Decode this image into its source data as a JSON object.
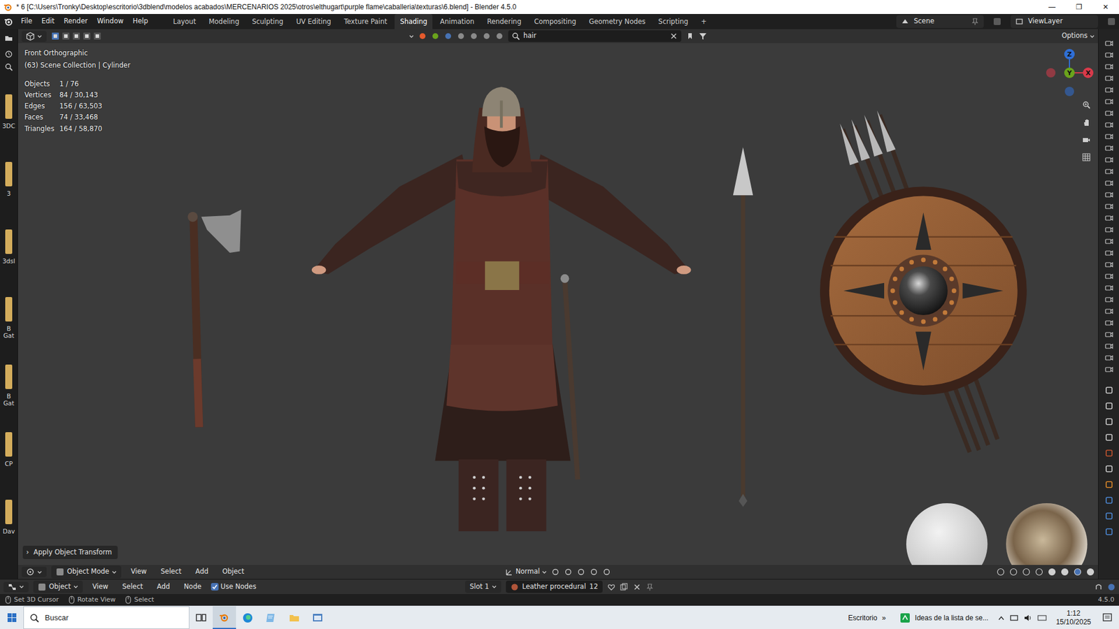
{
  "window": {
    "title": "* 6 [C:\\Users\\Tronky\\Desktop\\escritorio\\3dblend\\modelos acabados\\MERCENARIOS 2025\\otros\\elthugart\\purple flame\\caballeria\\texturas\\6.blend] - Blender 4.5.0",
    "controls": [
      "—",
      "❐",
      "✕"
    ]
  },
  "menubar": [
    "File",
    "Edit",
    "Render",
    "Window",
    "Help"
  ],
  "workspaces": [
    {
      "label": "Layout",
      "selected": false
    },
    {
      "label": "Modeling",
      "selected": false
    },
    {
      "label": "Sculpting",
      "selected": false
    },
    {
      "label": "UV Editing",
      "selected": false
    },
    {
      "label": "Texture Paint",
      "selected": false
    },
    {
      "label": "Shading",
      "selected": true
    },
    {
      "label": "Animation",
      "selected": false
    },
    {
      "label": "Rendering",
      "selected": false
    },
    {
      "label": "Compositing",
      "selected": false
    },
    {
      "label": "Geometry Nodes",
      "selected": false
    },
    {
      "label": "Scripting",
      "selected": false
    },
    {
      "label": "+",
      "selected": false
    }
  ],
  "topbar_right": {
    "scene": "Scene",
    "view_layer": "ViewLayer"
  },
  "file_strip": [
    {
      "lines": [
        "3DC"
      ]
    },
    {
      "lines": [
        "3"
      ]
    },
    {
      "lines": [
        "3dsl"
      ]
    },
    {
      "lines": [
        "B",
        "Gat"
      ]
    },
    {
      "lines": [
        "B",
        "Gat"
      ]
    },
    {
      "lines": [
        "CP"
      ]
    },
    {
      "lines": [
        "Dav"
      ]
    }
  ],
  "viewport_header": {
    "search": "hair",
    "options": "Options"
  },
  "overlay": {
    "view": "Front Orthographic",
    "collection": "(63) Scene Collection | Cylinder",
    "stats": [
      {
        "label": "Objects",
        "value": "1 / 76"
      },
      {
        "label": "Vertices",
        "value": "84 / 30,143"
      },
      {
        "label": "Edges",
        "value": "156 / 63,503"
      },
      {
        "label": "Faces",
        "value": "74 / 33,468"
      },
      {
        "label": "Triangles",
        "value": "164 / 58,870"
      }
    ]
  },
  "gizmo": {
    "axes": [
      {
        "label": "Z",
        "color": "#2f6fd6"
      },
      {
        "label": "Y",
        "color": "#6aa31c"
      },
      {
        "label": "X",
        "color": "#d83a4a"
      }
    ]
  },
  "last_operator": {
    "toggle": "›",
    "label": "Apply Object Transform",
    "expanded": false
  },
  "viewport_footer": {
    "mode": "Object Mode",
    "menus": [
      "View",
      "Select",
      "Add",
      "Object"
    ],
    "orientation": "Normal"
  },
  "node_header": {
    "editor": "Object",
    "menus": [
      "View",
      "Select",
      "Add",
      "Node"
    ],
    "use_nodes": {
      "label": "Use Nodes",
      "checked": true
    },
    "slot": "Slot 1",
    "material": "Leather procedural",
    "users": "12"
  },
  "status_bar": {
    "hints": [
      "Set 3D Cursor",
      "Rotate View",
      "Select"
    ],
    "version": "4.5.0"
  },
  "taskbar": {
    "search_placeholder": "Buscar",
    "apps": [
      {
        "kind": "taskview",
        "active": false
      },
      {
        "kind": "blender",
        "active": true
      },
      {
        "kind": "edge",
        "active": false
      },
      {
        "kind": "notepad",
        "active": false
      },
      {
        "kind": "explorer",
        "active": false
      },
      {
        "kind": "window",
        "active": false
      }
    ],
    "desktop": "Escritorio",
    "chevron": "»",
    "notification": "Ideas de la lista de se...",
    "time": "1:12",
    "date": "15/10/2025"
  }
}
